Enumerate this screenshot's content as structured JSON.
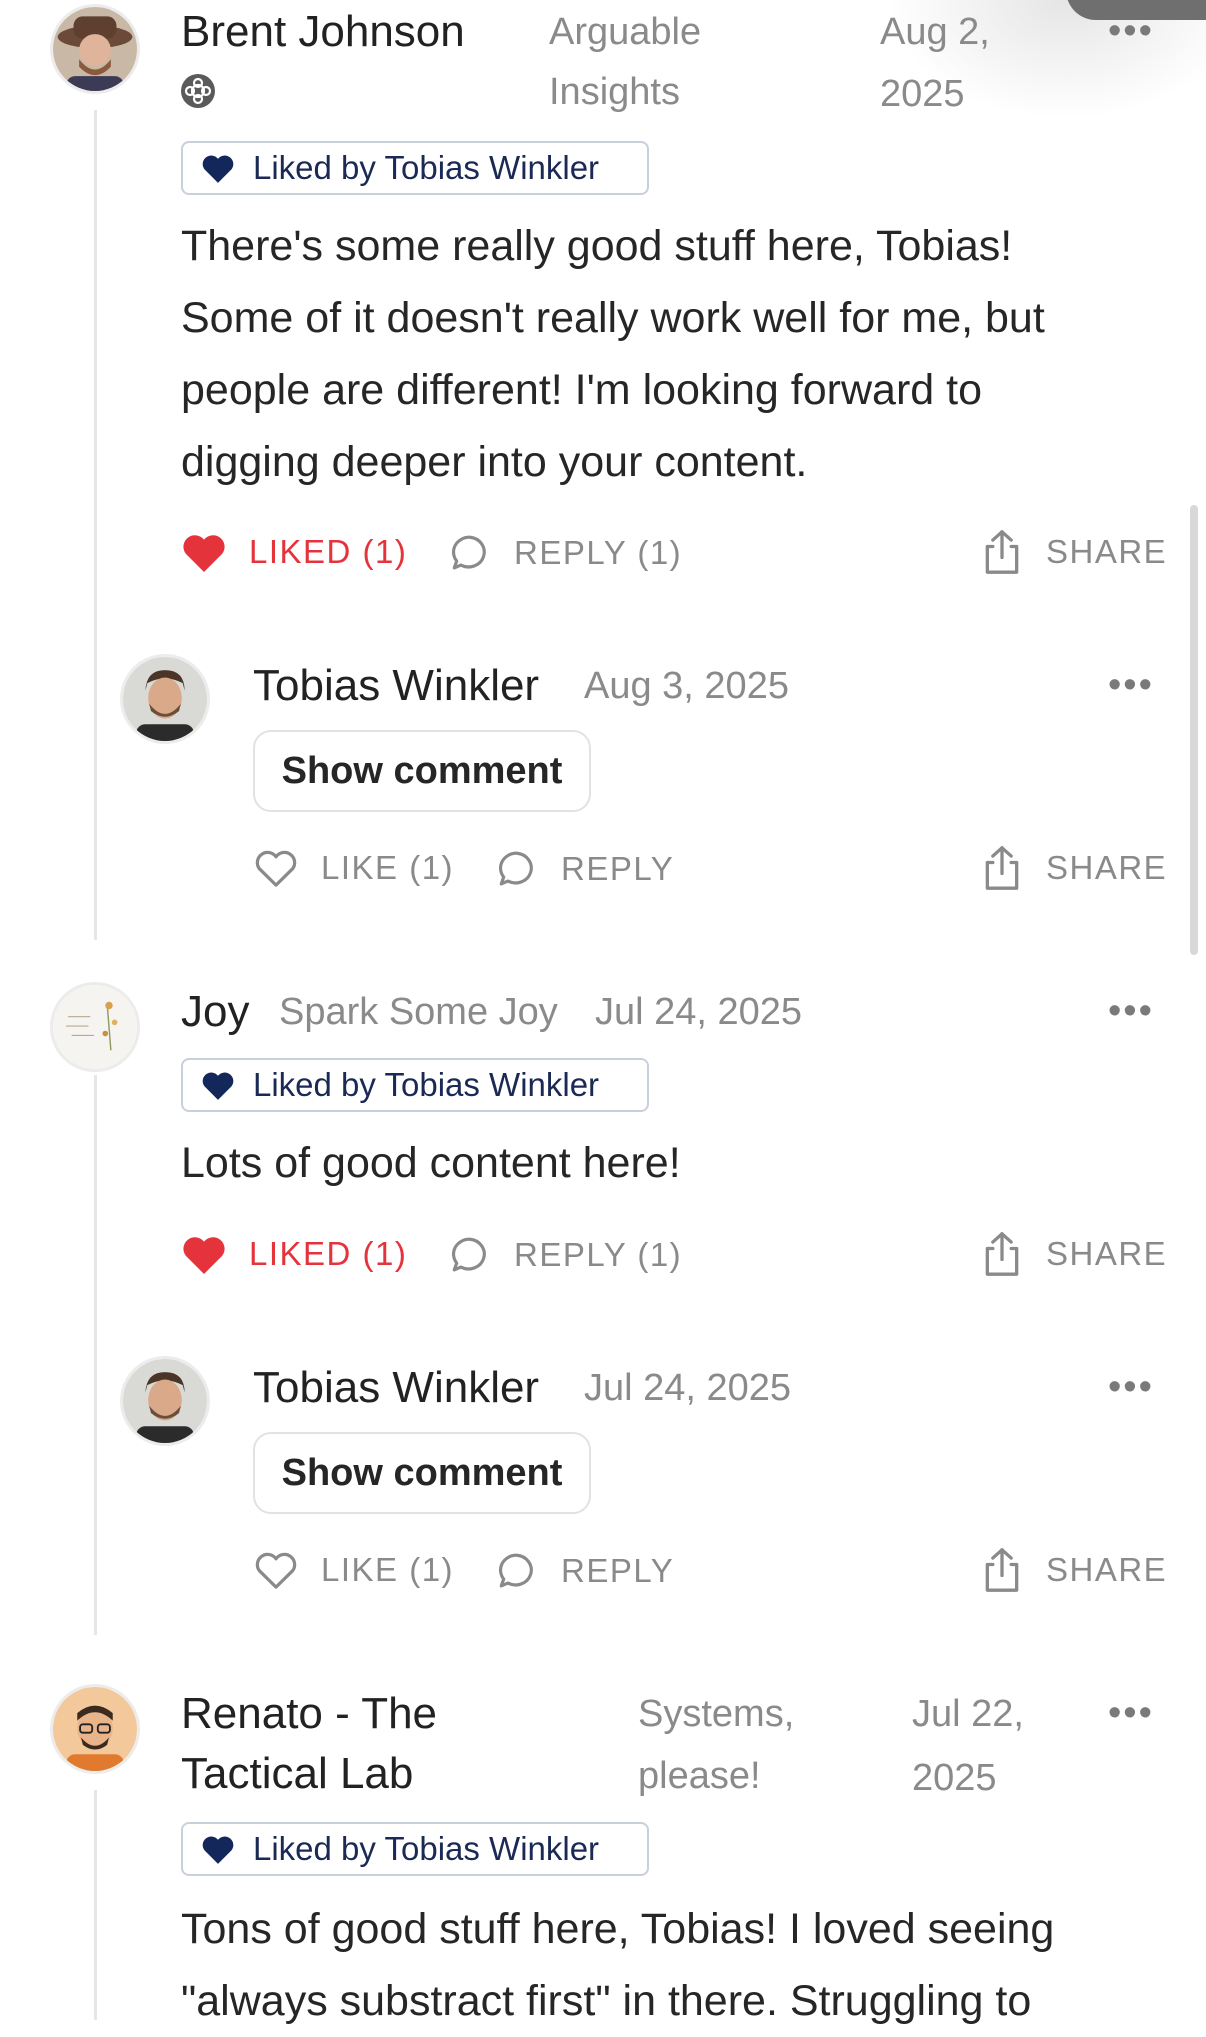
{
  "comments": [
    {
      "author": "Brent Johnson",
      "publication": [
        "Arguable",
        "Insights"
      ],
      "date": [
        "Aug 2,",
        "2025"
      ],
      "badge": "Liked by Tobias Winkler",
      "body": [
        "There's some really good stuff here, Tobias!",
        "Some of it doesn't really work well for me, but",
        "people are different! I'm looking forward to",
        "digging deeper into your content."
      ],
      "actions": {
        "like": "LIKED (1)",
        "reply": "REPLY (1)",
        "share": "SHARE"
      },
      "reply": {
        "author": "Tobias Winkler",
        "date": "Aug 3, 2025",
        "button": "Show comment",
        "actions": {
          "like": "LIKE (1)",
          "reply": "REPLY",
          "share": "SHARE"
        }
      }
    },
    {
      "author": "Joy",
      "publication": "Spark Some Joy",
      "date": "Jul 24, 2025",
      "badge": "Liked by Tobias Winkler",
      "body": [
        "Lots of good content here!"
      ],
      "actions": {
        "like": "LIKED (1)",
        "reply": "REPLY (1)",
        "share": "SHARE"
      },
      "reply": {
        "author": "Tobias Winkler",
        "date": "Jul 24, 2025",
        "button": "Show comment",
        "actions": {
          "like": "LIKE (1)",
          "reply": "REPLY",
          "share": "SHARE"
        }
      }
    },
    {
      "author": [
        "Renato - The",
        "Tactical Lab"
      ],
      "publication": [
        "Systems,",
        "please!"
      ],
      "date": [
        "Jul 22,",
        "2025"
      ],
      "badge": "Liked by Tobias Winkler",
      "body": [
        "Tons of good stuff here, Tobias! I loved seeing",
        "\"always substract first\" in there. Struggling to"
      ]
    }
  ],
  "more_label": "•••",
  "colors": {
    "liked_red": "#e5333c",
    "badge_navy": "#14275a",
    "muted": "#8a8a8a"
  },
  "icons": [
    "heart-icon",
    "comment-bubble-icon",
    "share-upload-icon",
    "more-dots-icon",
    "verified-badge-icon"
  ]
}
